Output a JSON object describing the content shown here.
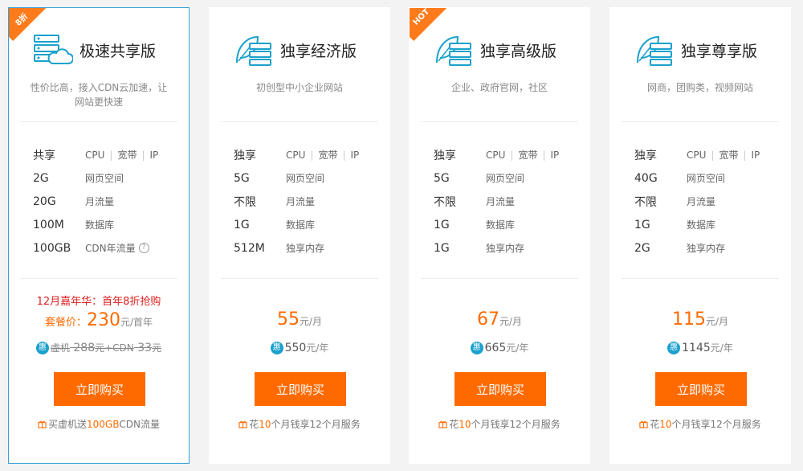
{
  "plans": [
    {
      "title": "极速共享版",
      "ribbon": "8折",
      "subtitle_lines": [
        "性价比高，接入CDN云加速，让",
        "网站更快速"
      ],
      "specs": [
        {
          "value": "共享",
          "keys": [
            "CPU",
            "宽带",
            "IP"
          ]
        },
        {
          "value": "2G",
          "keys": [
            "网页空间"
          ]
        },
        {
          "value": "20G",
          "keys": [
            "月流量"
          ]
        },
        {
          "value": "100M",
          "keys": [
            "数据库"
          ]
        },
        {
          "value": "100GB",
          "keys": [
            "CDN年流量"
          ]
        }
      ],
      "promo": "12月嘉年华：首年8折抢购",
      "package_label": "套餐价：",
      "package_price": "230",
      "package_unit": "元/首年",
      "discount_icon": "惠",
      "orig_prefix": "虚机",
      "orig_price_1": "288",
      "orig_unit_1": "元+CDN",
      "orig_price_2": "33",
      "orig_unit_2": "元",
      "buy_label": "立即购买",
      "footer_pre": "买虚机送",
      "footer_highlight": "100GB",
      "footer_post": " CDN流量"
    },
    {
      "title": "独享经济版",
      "subtitle_lines": [
        "初创型中小企业网站"
      ],
      "specs": [
        {
          "value": "独享",
          "keys": [
            "CPU",
            "宽带",
            "IP"
          ]
        },
        {
          "value": "5G",
          "keys": [
            "网页空间"
          ]
        },
        {
          "value": "不限",
          "keys": [
            "月流量"
          ]
        },
        {
          "value": "1G",
          "keys": [
            "数据库"
          ]
        },
        {
          "value": "512M",
          "keys": [
            "独享内存"
          ]
        }
      ],
      "price": "55",
      "price_unit": "元/月",
      "discount_icon": "惠",
      "year_price": "550",
      "year_unit": "元/年",
      "buy_label": "立即购买",
      "footer_pre": "花",
      "footer_highlight": "10",
      "footer_post": "个月钱享12个月服务"
    },
    {
      "title": "独享高级版",
      "ribbon": "HOT",
      "subtitle_lines": [
        "企业、政府官网，社区"
      ],
      "specs": [
        {
          "value": "独享",
          "keys": [
            "CPU",
            "宽带",
            "IP"
          ]
        },
        {
          "value": "5G",
          "keys": [
            "网页空间"
          ]
        },
        {
          "value": "不限",
          "keys": [
            "月流量"
          ]
        },
        {
          "value": "1G",
          "keys": [
            "数据库"
          ]
        },
        {
          "value": "1G",
          "keys": [
            "独享内存"
          ]
        }
      ],
      "price": "67",
      "price_unit": "元/月",
      "discount_icon": "惠",
      "year_price": "665",
      "year_unit": "元/年",
      "buy_label": "立即购买",
      "footer_pre": "花",
      "footer_highlight": "10",
      "footer_post": "个月钱享12个月服务"
    },
    {
      "title": "独享尊享版",
      "subtitle_lines": [
        "网商，团购类，视频网站"
      ],
      "specs": [
        {
          "value": "独享",
          "keys": [
            "CPU",
            "宽带",
            "IP"
          ]
        },
        {
          "value": "40G",
          "keys": [
            "网页空间"
          ]
        },
        {
          "value": "不限",
          "keys": [
            "月流量"
          ]
        },
        {
          "value": "1G",
          "keys": [
            "数据库"
          ]
        },
        {
          "value": "2G",
          "keys": [
            "独享内存"
          ]
        }
      ],
      "price": "115",
      "price_unit": "元/月",
      "discount_icon": "惠",
      "year_price": "1145",
      "year_unit": "元/年",
      "buy_label": "立即购买",
      "footer_pre": "花",
      "footer_highlight": "10",
      "footer_post": "个月钱享12个月服务"
    }
  ],
  "colors": {
    "accent": "#ff6a00",
    "border_active": "#3a9fd6",
    "icon": "#1ba1cc",
    "promo": "#e02020"
  }
}
